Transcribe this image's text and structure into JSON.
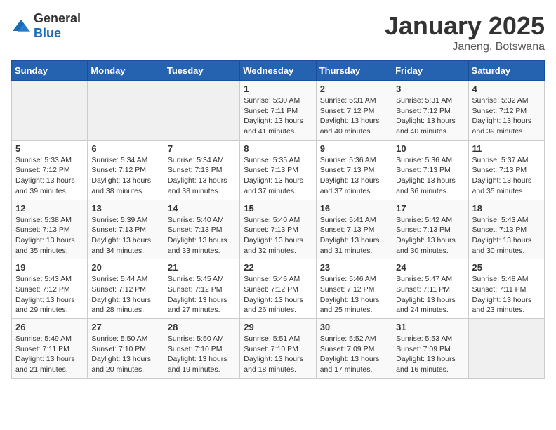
{
  "header": {
    "logo_general": "General",
    "logo_blue": "Blue",
    "title": "January 2025",
    "subtitle": "Janeng, Botswana"
  },
  "days_of_week": [
    "Sunday",
    "Monday",
    "Tuesday",
    "Wednesday",
    "Thursday",
    "Friday",
    "Saturday"
  ],
  "weeks": [
    [
      {
        "day": "",
        "info": ""
      },
      {
        "day": "",
        "info": ""
      },
      {
        "day": "",
        "info": ""
      },
      {
        "day": "1",
        "info": "Sunrise: 5:30 AM\nSunset: 7:11 PM\nDaylight: 13 hours and 41 minutes."
      },
      {
        "day": "2",
        "info": "Sunrise: 5:31 AM\nSunset: 7:12 PM\nDaylight: 13 hours and 40 minutes."
      },
      {
        "day": "3",
        "info": "Sunrise: 5:31 AM\nSunset: 7:12 PM\nDaylight: 13 hours and 40 minutes."
      },
      {
        "day": "4",
        "info": "Sunrise: 5:32 AM\nSunset: 7:12 PM\nDaylight: 13 hours and 39 minutes."
      }
    ],
    [
      {
        "day": "5",
        "info": "Sunrise: 5:33 AM\nSunset: 7:12 PM\nDaylight: 13 hours and 39 minutes."
      },
      {
        "day": "6",
        "info": "Sunrise: 5:34 AM\nSunset: 7:12 PM\nDaylight: 13 hours and 38 minutes."
      },
      {
        "day": "7",
        "info": "Sunrise: 5:34 AM\nSunset: 7:13 PM\nDaylight: 13 hours and 38 minutes."
      },
      {
        "day": "8",
        "info": "Sunrise: 5:35 AM\nSunset: 7:13 PM\nDaylight: 13 hours and 37 minutes."
      },
      {
        "day": "9",
        "info": "Sunrise: 5:36 AM\nSunset: 7:13 PM\nDaylight: 13 hours and 37 minutes."
      },
      {
        "day": "10",
        "info": "Sunrise: 5:36 AM\nSunset: 7:13 PM\nDaylight: 13 hours and 36 minutes."
      },
      {
        "day": "11",
        "info": "Sunrise: 5:37 AM\nSunset: 7:13 PM\nDaylight: 13 hours and 35 minutes."
      }
    ],
    [
      {
        "day": "12",
        "info": "Sunrise: 5:38 AM\nSunset: 7:13 PM\nDaylight: 13 hours and 35 minutes."
      },
      {
        "day": "13",
        "info": "Sunrise: 5:39 AM\nSunset: 7:13 PM\nDaylight: 13 hours and 34 minutes."
      },
      {
        "day": "14",
        "info": "Sunrise: 5:40 AM\nSunset: 7:13 PM\nDaylight: 13 hours and 33 minutes."
      },
      {
        "day": "15",
        "info": "Sunrise: 5:40 AM\nSunset: 7:13 PM\nDaylight: 13 hours and 32 minutes."
      },
      {
        "day": "16",
        "info": "Sunrise: 5:41 AM\nSunset: 7:13 PM\nDaylight: 13 hours and 31 minutes."
      },
      {
        "day": "17",
        "info": "Sunrise: 5:42 AM\nSunset: 7:13 PM\nDaylight: 13 hours and 30 minutes."
      },
      {
        "day": "18",
        "info": "Sunrise: 5:43 AM\nSunset: 7:13 PM\nDaylight: 13 hours and 30 minutes."
      }
    ],
    [
      {
        "day": "19",
        "info": "Sunrise: 5:43 AM\nSunset: 7:12 PM\nDaylight: 13 hours and 29 minutes."
      },
      {
        "day": "20",
        "info": "Sunrise: 5:44 AM\nSunset: 7:12 PM\nDaylight: 13 hours and 28 minutes."
      },
      {
        "day": "21",
        "info": "Sunrise: 5:45 AM\nSunset: 7:12 PM\nDaylight: 13 hours and 27 minutes."
      },
      {
        "day": "22",
        "info": "Sunrise: 5:46 AM\nSunset: 7:12 PM\nDaylight: 13 hours and 26 minutes."
      },
      {
        "day": "23",
        "info": "Sunrise: 5:46 AM\nSunset: 7:12 PM\nDaylight: 13 hours and 25 minutes."
      },
      {
        "day": "24",
        "info": "Sunrise: 5:47 AM\nSunset: 7:11 PM\nDaylight: 13 hours and 24 minutes."
      },
      {
        "day": "25",
        "info": "Sunrise: 5:48 AM\nSunset: 7:11 PM\nDaylight: 13 hours and 23 minutes."
      }
    ],
    [
      {
        "day": "26",
        "info": "Sunrise: 5:49 AM\nSunset: 7:11 PM\nDaylight: 13 hours and 21 minutes."
      },
      {
        "day": "27",
        "info": "Sunrise: 5:50 AM\nSunset: 7:10 PM\nDaylight: 13 hours and 20 minutes."
      },
      {
        "day": "28",
        "info": "Sunrise: 5:50 AM\nSunset: 7:10 PM\nDaylight: 13 hours and 19 minutes."
      },
      {
        "day": "29",
        "info": "Sunrise: 5:51 AM\nSunset: 7:10 PM\nDaylight: 13 hours and 18 minutes."
      },
      {
        "day": "30",
        "info": "Sunrise: 5:52 AM\nSunset: 7:09 PM\nDaylight: 13 hours and 17 minutes."
      },
      {
        "day": "31",
        "info": "Sunrise: 5:53 AM\nSunset: 7:09 PM\nDaylight: 13 hours and 16 minutes."
      },
      {
        "day": "",
        "info": ""
      }
    ]
  ]
}
